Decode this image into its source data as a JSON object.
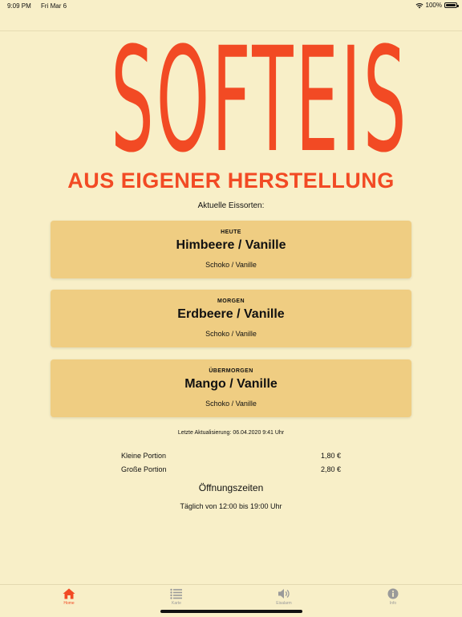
{
  "status": {
    "time": "9:09 PM",
    "date": "Fri Mar 6",
    "battery": "100%"
  },
  "logo": {
    "title": "SOFTEIS",
    "tagline": "AUS EIGENER HERSTELLUNG"
  },
  "flavors": {
    "label": "Aktuelle Eissorten:",
    "cards": [
      {
        "day": "HEUTE",
        "main": "Himbeere / Vanille",
        "alt": "Schoko / Vanille"
      },
      {
        "day": "MORGEN",
        "main": "Erdbeere / Vanille",
        "alt": "Schoko / Vanille"
      },
      {
        "day": "ÜBERMORGEN",
        "main": "Mango / Vanille",
        "alt": "Schoko / Vanille"
      }
    ]
  },
  "updated": "Letzte Aktualisierung: 06.04.2020 9:41 Uhr",
  "prices": [
    {
      "label": "Kleine Portion",
      "value": "1,80 €"
    },
    {
      "label": "Große Portion",
      "value": "2,80 €"
    }
  ],
  "hours": {
    "title": "Öffnungszeiten",
    "text": "Täglich von 12:00 bis 19:00 Uhr"
  },
  "tabs": [
    {
      "label": "Home",
      "icon": "home-icon",
      "active": true
    },
    {
      "label": "Karte",
      "icon": "list-icon",
      "active": false
    },
    {
      "label": "Eisalarm",
      "icon": "speaker-icon",
      "active": false
    },
    {
      "label": "Info",
      "icon": "info-icon",
      "active": false
    }
  ],
  "colors": {
    "background": "#f8efc8",
    "accent": "#f24a24",
    "card": "#efcd82",
    "inactive": "#9a9a9a"
  }
}
